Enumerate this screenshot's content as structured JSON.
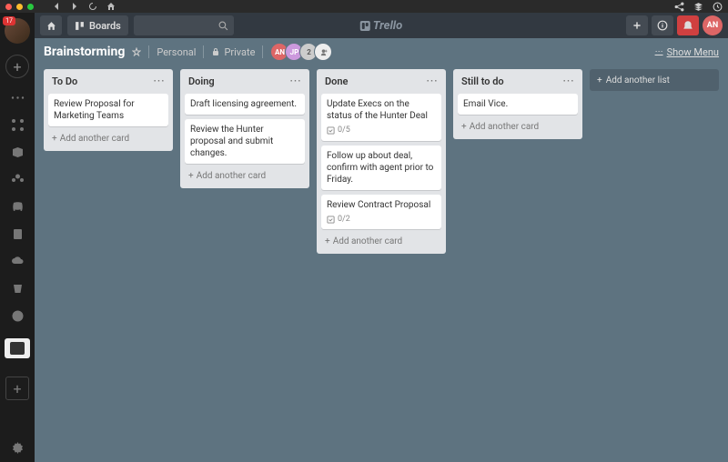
{
  "sidebar": {
    "notification_count": "17"
  },
  "topbar": {
    "boards_label": "Boards",
    "logo_text": "Trello",
    "avatar_initials": "AN"
  },
  "boardbar": {
    "title": "Brainstorming",
    "personal": "Personal",
    "private": "Private",
    "members": [
      "AN",
      "JP",
      "2"
    ],
    "show_menu": "Show Menu"
  },
  "lists": [
    {
      "title": "To Do",
      "cards": [
        {
          "text": "Review Proposal for Marketing Teams"
        }
      ],
      "add": "Add another card"
    },
    {
      "title": "Doing",
      "cards": [
        {
          "text": "Draft licensing agreement."
        },
        {
          "text": "Review the Hunter proposal and submit changes."
        }
      ],
      "add": "Add another card"
    },
    {
      "title": "Done",
      "cards": [
        {
          "text": "Update Execs on the status of the Hunter Deal",
          "checklist": "0/5"
        },
        {
          "text": "Follow up about deal, confirm with agent prior to Friday."
        },
        {
          "text": "Review Contract Proposal",
          "checklist": "0/2"
        }
      ],
      "add": "Add another card"
    },
    {
      "title": "Still to do",
      "cards": [
        {
          "text": "Email Vice."
        }
      ],
      "add": "Add another card"
    }
  ],
  "add_list": "Add another list"
}
